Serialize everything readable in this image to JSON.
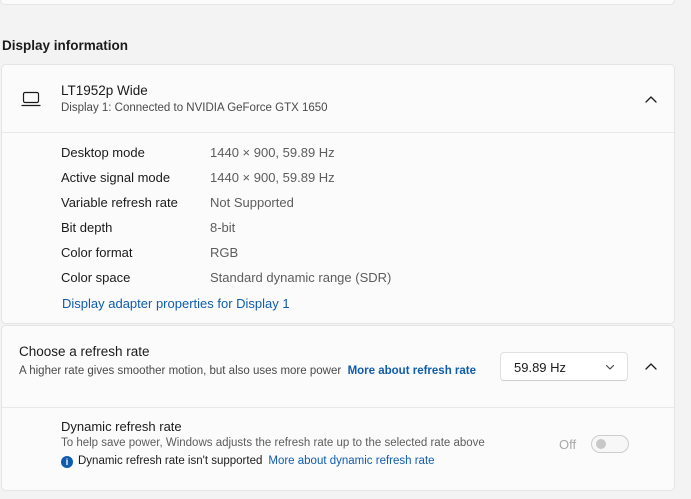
{
  "section": {
    "heading": "Display information"
  },
  "display": {
    "name": "LT1952p Wide",
    "subtitle": "Display 1: Connected to NVIDIA GeForce GTX 1650",
    "specs": [
      {
        "label": "Desktop mode",
        "value": "1440 × 900, 59.89 Hz"
      },
      {
        "label": "Active signal mode",
        "value": "1440 × 900, 59.89 Hz"
      },
      {
        "label": "Variable refresh rate",
        "value": "Not Supported"
      },
      {
        "label": "Bit depth",
        "value": "8-bit"
      },
      {
        "label": "Color format",
        "value": "RGB"
      },
      {
        "label": "Color space",
        "value": "Standard dynamic range (SDR)"
      }
    ],
    "adapter_link": "Display adapter properties for Display 1"
  },
  "refresh": {
    "title": "Choose a refresh rate",
    "description": "A higher rate gives smoother motion, but also uses more power",
    "more_link": "More about refresh rate",
    "selected_rate": "59.89 Hz"
  },
  "dynamic": {
    "title": "Dynamic refresh rate",
    "description": "To help save power, Windows adjusts the refresh rate up to the selected rate above",
    "note": "Dynamic refresh rate isn't supported",
    "note_link": "More about dynamic refresh rate",
    "toggle_state": "Off",
    "info_glyph": "i"
  },
  "icons": [
    "monitor-icon",
    "chevron-up-icon",
    "chevron-down-icon",
    "info-icon"
  ],
  "colors": {
    "accent": "#0f5cad",
    "background": "#f3f3f3",
    "card": "#fbfbfb"
  }
}
